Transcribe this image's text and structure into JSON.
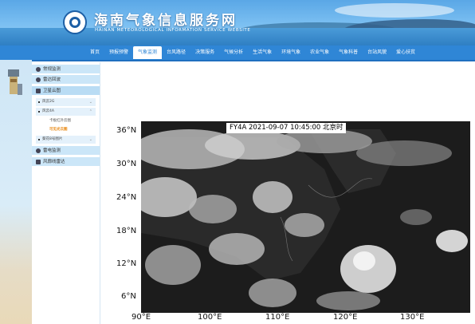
{
  "header": {
    "title": "海南气象信息服务网",
    "subtitle": "HAINAN METEOROLOGICAL INFORMATION SERVICE WEBSITE"
  },
  "nav": {
    "items": [
      "首页",
      "预报预警",
      "气象监测",
      "台风路径",
      "决策服务",
      "气候分析",
      "生活气象",
      "环境气象",
      "农业气象",
      "气象科普",
      "台站风貌",
      "爱心扶贫"
    ],
    "active_index": 2
  },
  "sidebar": {
    "items": [
      {
        "label": "常规监测",
        "icon": "gear-icon"
      },
      {
        "label": "雷达回波",
        "icon": "radar-icon"
      },
      {
        "label": "卫星云图",
        "icon": "satellite-icon"
      },
      {
        "label": "雷电监测",
        "icon": "cloud-lightning-icon"
      },
      {
        "label": "风廓线雷达",
        "icon": "book-icon"
      }
    ],
    "sub_items": [
      {
        "label": "风云2G"
      },
      {
        "label": "风云4A"
      },
      {
        "label": "葵花8号图片"
      }
    ],
    "leaves": [
      {
        "label": "卡板红外云图"
      },
      {
        "label": "可见光云图",
        "active": true
      }
    ]
  },
  "satellite": {
    "caption": "FY4A  2021-09-07 10:45:00  北京时",
    "lat_labels": [
      "36°N",
      "30°N",
      "24°N",
      "18°N",
      "12°N",
      "6°N"
    ],
    "lon_labels": [
      "90°E",
      "100°E",
      "110°E",
      "120°E",
      "130°E"
    ]
  }
}
